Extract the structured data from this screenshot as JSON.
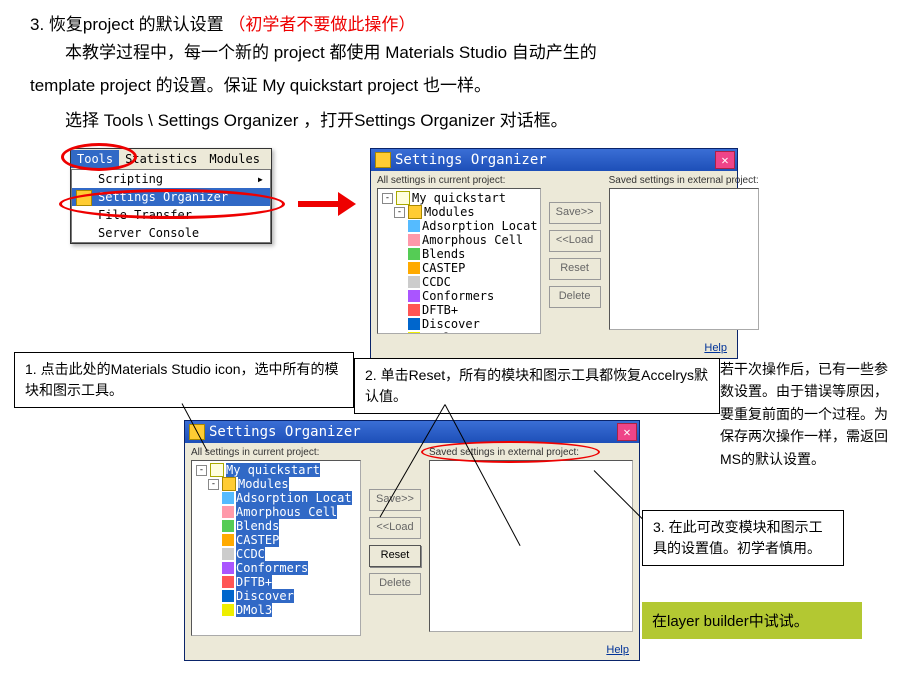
{
  "heading": {
    "num": "3.",
    "main": "恢复project 的默认设置",
    "warn": "（初学者不要做此操作）"
  },
  "para1a": "本教学过程中，每一个新的 project 都使用 Materials Studio 自动产生的",
  "para1b": "template project 的设置。保证 My quickstart project 也一样。",
  "para2": "选择 Tools \\ Settings Organizer ，打开Settings Organizer 对话框。",
  "menubar": {
    "tools": "Tools",
    "stats": "Statistics",
    "modules": "Modules"
  },
  "menu": {
    "scripting": "Scripting",
    "settings": "Settings Organizer",
    "filetransfer": "File Transfer",
    "server": "Server Console"
  },
  "dlg": {
    "title": "Settings Organizer",
    "left_label": "All settings in current project:",
    "right_label": "Saved settings in external project:",
    "root": "My quickstart",
    "modules": "Modules",
    "items": [
      "Adsorption Locat",
      "Amorphous Cell",
      "Blends",
      "CASTEP",
      "CCDC",
      "Conformers",
      "DFTB+",
      "Discover",
      "DMol3"
    ],
    "btns": {
      "save": "Save>>",
      "load": "<<Load",
      "reset": "Reset",
      "delete": "Delete"
    },
    "help": "Help"
  },
  "callout1": "1. 点击此处的Materials Studio icon，选中所有的模块和图示工具。",
  "callout2": "2. 单击Reset，所有的模块和图示工具都恢复Accelrys默认值。",
  "callout3": "3. 在此可改变模块和图示工具的设置值。初学者慎用。",
  "rightpara": "若干次操作后，已有一些参数设置。由于错误等原因，要重复前面的一个过程。为保存两次操作一样，需返回MS的默认设置。",
  "greennote": "在layer builder中试试。"
}
